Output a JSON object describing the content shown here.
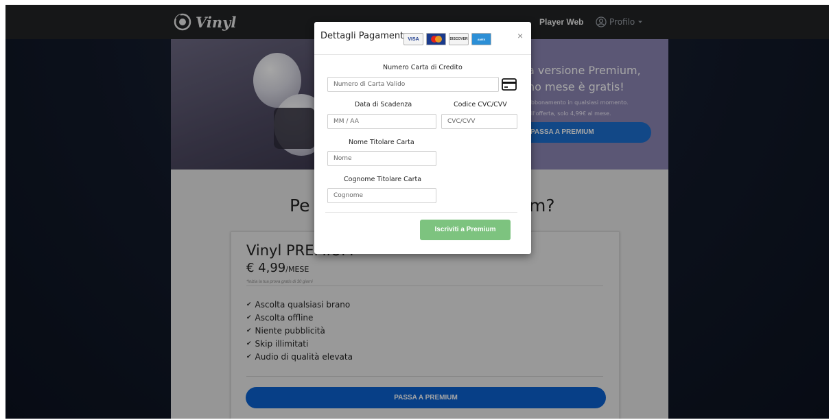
{
  "nav": {
    "logo_text": "Vinyl",
    "player_web": "Player Web",
    "profile": "Profilo"
  },
  "hero": {
    "headline_1": "a versione Premium,",
    "headline_2": "no mese è gratis!",
    "sub_1": "abbonamento in qualsiasi momento.",
    "sub_2": "ell'offerta, solo 4,99€ al mese.",
    "button": "PASSA A PREMIUM"
  },
  "section": {
    "title_left": "Pe",
    "title_right": "ım?"
  },
  "card": {
    "plan_name": "Vinyl PREMIUM",
    "price": "€ 4,99",
    "period": "/MESE",
    "note": "*Inizia la tua prova gratis di 30 giorni",
    "features": [
      "Ascolta qualsiasi brano",
      "Ascolta offline",
      "Niente pubblicità",
      "Skip illimitati",
      "Audio di qualità elevata"
    ],
    "button": "PASSA A PREMIUM"
  },
  "modal": {
    "title": "Dettagli Pagamento",
    "card_logos": [
      "VISA",
      "MasterCard",
      "DISCOVER",
      "AMERICAN EXPRESS"
    ],
    "close": "×",
    "card_number_label": "Numero Carta di Credito",
    "card_number_placeholder": "Numero di Carta Valido",
    "expiry_label": "Data di Scadenza",
    "expiry_placeholder": "MM / AA",
    "cvc_label": "Codice CVC/CVV",
    "cvc_placeholder": "CVC/CVV",
    "first_name_label": "Nome Titolare Carta",
    "first_name_placeholder": "Nome",
    "last_name_label": "Cognome Titolare Carta",
    "last_name_placeholder": "Cognome",
    "submit": "Iscriviti a Premium"
  },
  "colors": {
    "topbar": "#232425",
    "hero": "#8d86b4",
    "primary_button": "#0b62d0",
    "submit_button": "#7dc37f"
  }
}
